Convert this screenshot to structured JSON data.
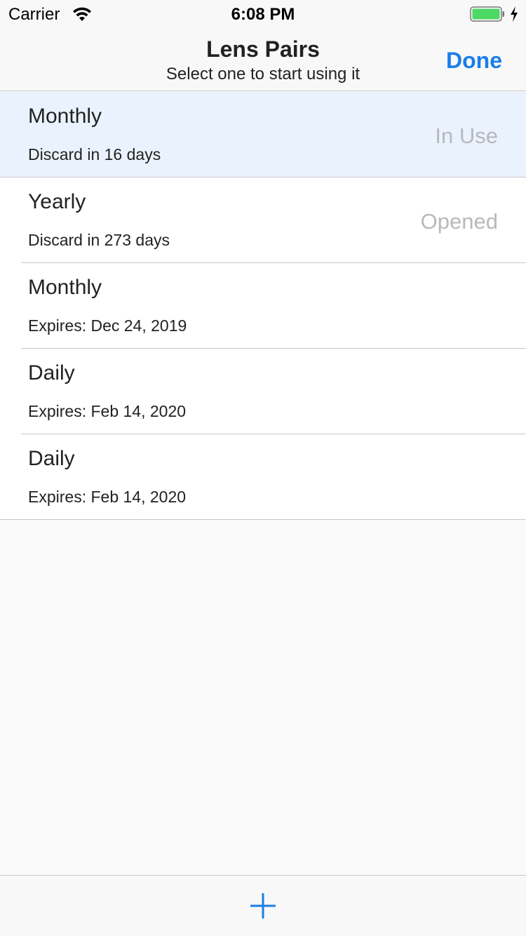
{
  "status_bar": {
    "carrier": "Carrier",
    "time": "6:08 PM",
    "wifi_icon": "wifi-icon",
    "battery_icon": "battery-icon",
    "charging_icon": "bolt-icon",
    "battery_color": "#4cd964"
  },
  "nav": {
    "title": "Lens Pairs",
    "subtitle": "Select one to start using it",
    "done_label": "Done",
    "accent_color": "#1a7ee6"
  },
  "lens_pairs": [
    {
      "title": "Monthly",
      "detail": "Discard in 16 days",
      "status": "In Use",
      "selected": true
    },
    {
      "title": "Yearly",
      "detail": "Discard in 273 days",
      "status": "Opened",
      "selected": false
    },
    {
      "title": "Monthly",
      "detail": "Expires: Dec 24, 2019",
      "status": "",
      "selected": false
    },
    {
      "title": "Daily",
      "detail": "Expires: Feb 14, 2020",
      "status": "",
      "selected": false
    },
    {
      "title": "Daily",
      "detail": "Expires: Feb 14, 2020",
      "status": "",
      "selected": false
    }
  ],
  "toolbar": {
    "add_icon": "plus-icon"
  }
}
